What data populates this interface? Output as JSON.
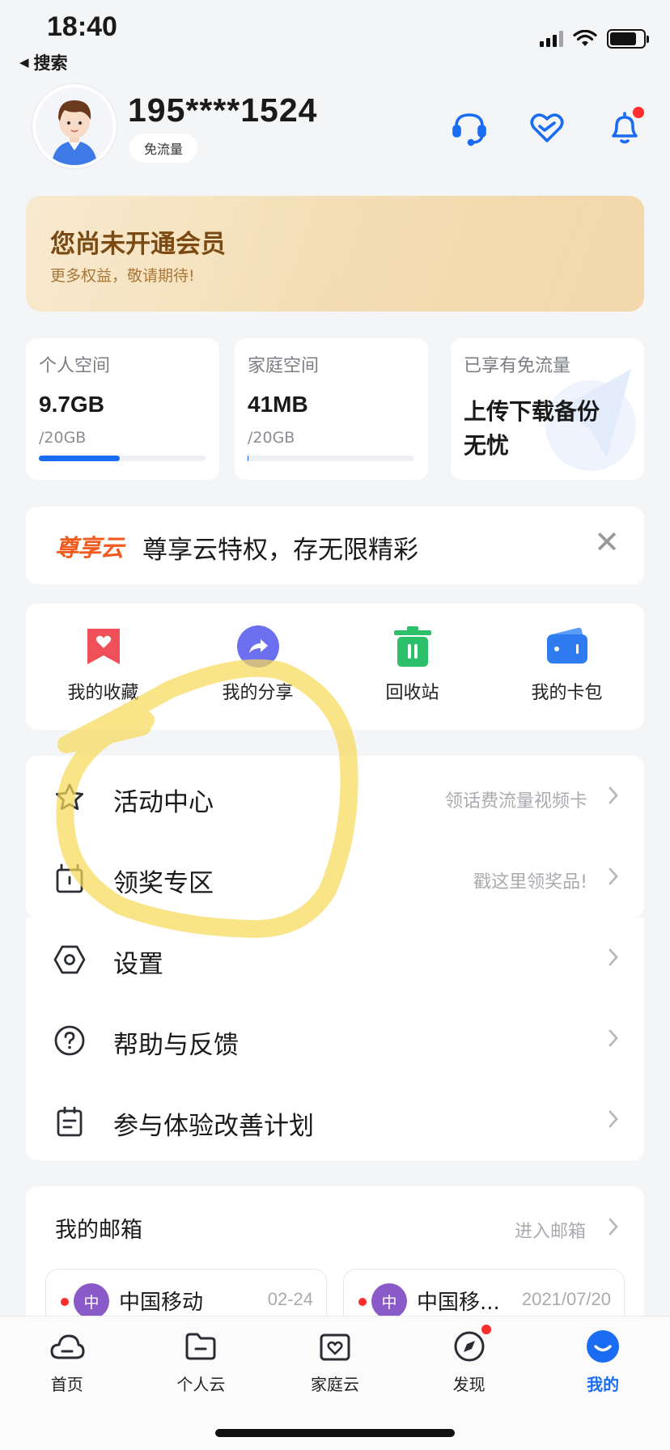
{
  "status_bar": {
    "time": "18:40",
    "back_label": "搜索"
  },
  "profile": {
    "phone": "195****1524",
    "badge": "免流量"
  },
  "member": {
    "title": "您尚未开通会员",
    "subtitle": "更多权益，敬请期待!"
  },
  "storage": [
    {
      "label": "个人空间",
      "value": "9.7GB",
      "total": "/20GB",
      "progress": 0.485
    },
    {
      "label": "家庭空间",
      "value": "41MB",
      "total": "/20GB",
      "progress": 0.002
    },
    {
      "label": "已享有免流量",
      "text": "上传下载备份无忧"
    }
  ],
  "promo": {
    "logo": "尊享云",
    "text": "尊享云特权，存无限精彩",
    "close": "✕"
  },
  "shortcuts": [
    {
      "label": "我的收藏",
      "icon": "bookmark-heart-icon",
      "color": "#f0505a"
    },
    {
      "label": "我的分享",
      "icon": "share-icon",
      "color": "#6b6ff0"
    },
    {
      "label": "回收站",
      "icon": "trash-icon",
      "color": "#2cc06b"
    },
    {
      "label": "我的卡包",
      "icon": "wallet-icon",
      "color": "#2f7cf0"
    }
  ],
  "list": [
    {
      "title": "活动中心",
      "hint": "领话费流量视频卡",
      "icon": "star-icon"
    },
    {
      "title": "领奖专区",
      "hint": "戳这里领奖品!",
      "icon": "gift-box-icon"
    },
    {
      "title": "设置",
      "hint": "",
      "icon": "settings-hexagon-icon"
    },
    {
      "title": "帮助与反馈",
      "hint": "",
      "icon": "help-circle-icon"
    },
    {
      "title": "参与体验改善计划",
      "hint": "",
      "icon": "clipboard-icon"
    }
  ],
  "mailbox": {
    "title": "我的邮箱",
    "link": "进入邮箱",
    "items": [
      {
        "avatar": "中",
        "sender": "中国移动",
        "date": "02-24"
      },
      {
        "avatar": "中",
        "sender": "中国移...",
        "date": "2021/07/20"
      }
    ]
  },
  "tabbar": [
    {
      "label": "首页",
      "icon": "cloud-icon",
      "active": false
    },
    {
      "label": "个人云",
      "icon": "folder-icon",
      "active": false
    },
    {
      "label": "家庭云",
      "icon": "family-heart-icon",
      "active": false
    },
    {
      "label": "发现",
      "icon": "compass-icon",
      "active": false
    },
    {
      "label": "我的",
      "icon": "profile-smile-icon",
      "active": true
    }
  ],
  "colors": {
    "accent": "#1a6cf2",
    "member_gold": "#7a4a12",
    "highlight": "#f8d95a"
  }
}
